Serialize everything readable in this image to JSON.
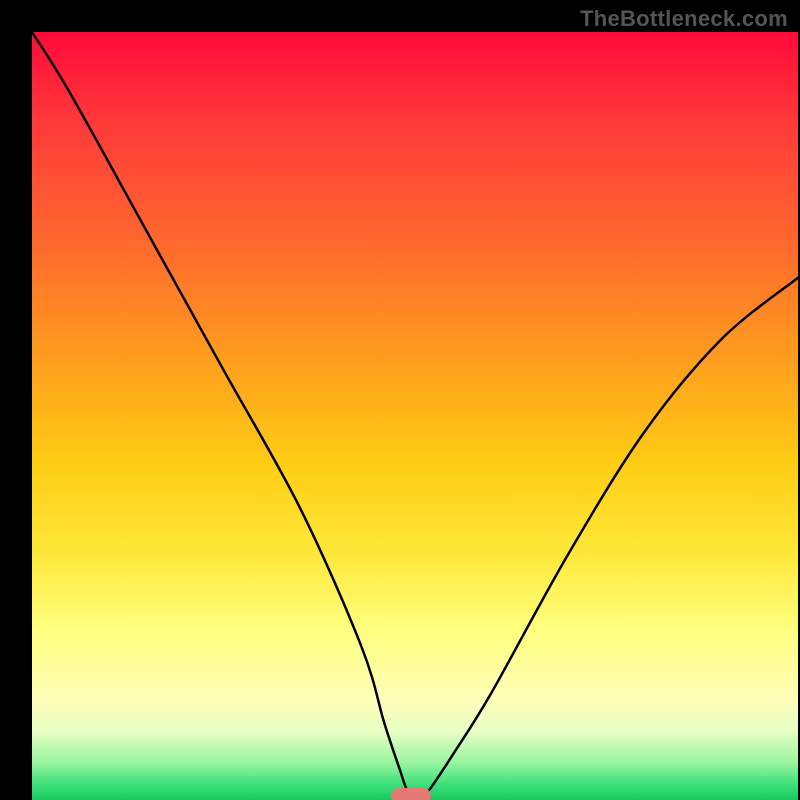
{
  "watermark": "TheBottleneck.com",
  "chart_data": {
    "type": "line",
    "title": "",
    "xlabel": "",
    "ylabel": "",
    "xlim": [
      0,
      100
    ],
    "ylim": [
      0,
      100
    ],
    "grid": false,
    "series": [
      {
        "name": "bottleneck-curve",
        "x": [
          0,
          5,
          15,
          25,
          35,
          43,
          46,
          48,
          49,
          50,
          51,
          52,
          55,
          60,
          70,
          80,
          90,
          100
        ],
        "values": [
          100,
          92,
          74,
          56,
          38,
          20,
          10,
          4,
          1.2,
          0.5,
          0.5,
          1.5,
          6,
          14,
          32,
          48,
          60,
          68
        ]
      }
    ],
    "annotations": [
      {
        "name": "sweet-spot-marker",
        "x": 49.5,
        "y": 0.5
      }
    ],
    "background": {
      "type": "vertical-gradient",
      "stops": [
        {
          "pct": 0,
          "color": "#ff0a3a"
        },
        {
          "pct": 50,
          "color": "#ffd21f"
        },
        {
          "pct": 85,
          "color": "#ffffba"
        },
        {
          "pct": 100,
          "color": "#16c85e"
        }
      ]
    }
  }
}
